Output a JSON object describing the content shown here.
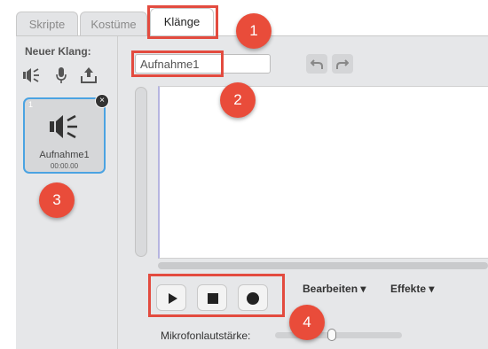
{
  "tabs": [
    {
      "label": "Skripte"
    },
    {
      "label": "Kostüme"
    },
    {
      "label": "Klänge",
      "active": true
    }
  ],
  "left_panel": {
    "title": "Neuer Klang:",
    "tools": [
      "speaker-library-icon",
      "microphone-icon",
      "upload-icon"
    ],
    "sounds": [
      {
        "index": "1",
        "name": "Aufnahme1",
        "duration": "00:00.00"
      }
    ]
  },
  "editor": {
    "sound_name_value": "Aufnahme1",
    "undo_icon": "undo-icon",
    "redo_icon": "redo-icon",
    "controls": [
      "play-icon",
      "stop-icon",
      "record-icon"
    ],
    "menu_edit": "Bearbeiten ▾",
    "menu_effects": "Effekte ▾",
    "mic_volume_label": "Mikrofonlautstärke:",
    "mic_volume_level": 0.45
  },
  "annotations": [
    "1",
    "2",
    "3",
    "4"
  ],
  "colors": {
    "annotation_red": "#e94c3a",
    "selection_blue": "#4ba3e2",
    "panel_gray": "#e6e7e9"
  }
}
